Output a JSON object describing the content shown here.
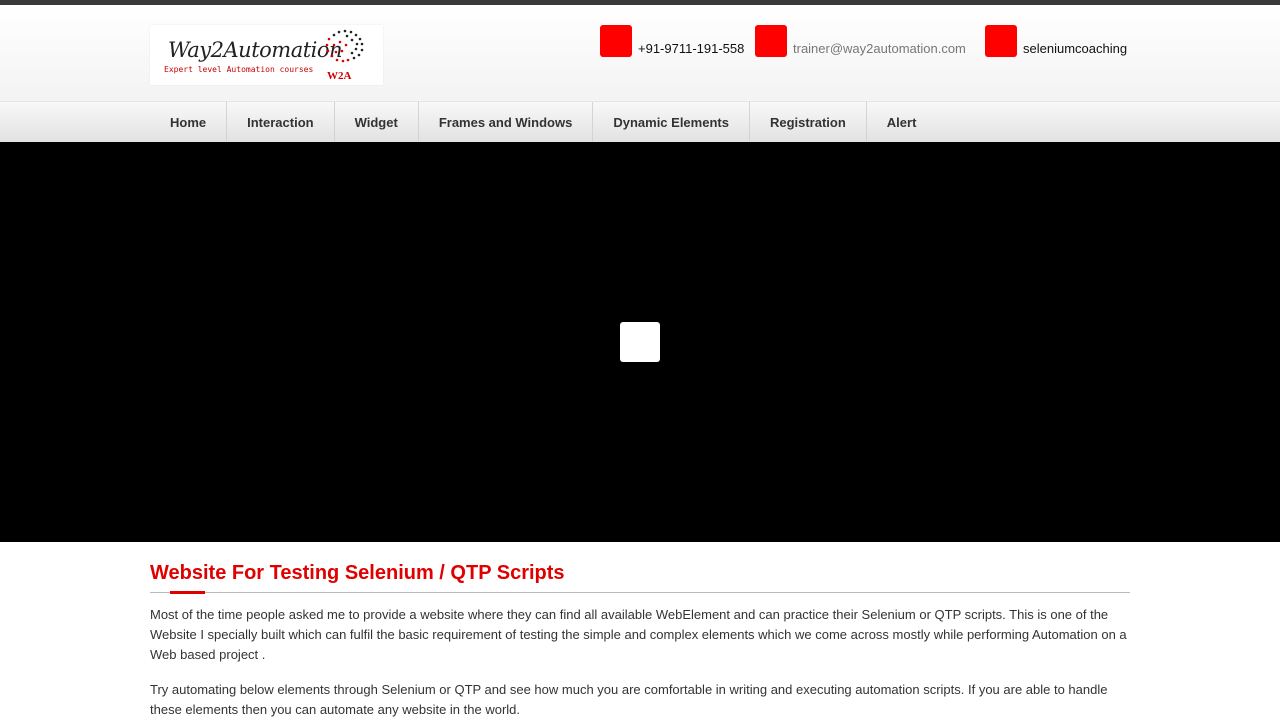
{
  "header": {
    "logo": {
      "brand": "Way2Automation",
      "tagline": "Expert level Automation courses",
      "mark": "W2A"
    },
    "contacts": [
      {
        "icon": "phone-icon",
        "text": "+91-9711-191-558"
      },
      {
        "icon": "email-icon",
        "text": "trainer@way2automation.com"
      },
      {
        "icon": "skype-icon",
        "text": "seleniumcoaching"
      }
    ]
  },
  "nav": {
    "items": [
      "Home",
      "Interaction",
      "Widget",
      "Frames and Windows",
      "Dynamic Elements",
      "Registration",
      "Alert"
    ]
  },
  "video": {
    "play_icon": "play-icon"
  },
  "main": {
    "title": "Website For Testing Selenium / QTP Scripts",
    "paragraphs": [
      "Most of the time people asked me to provide a website where they can find all available WebElement and can practice their Selenium or QTP scripts. This is one of the Website I specially built which can fulfil the basic requirement of testing the simple and complex elements which we come across mostly while performing Automation on a Web based project .",
      "Try automating below elements through Selenium or QTP and see how much you are comfortable in writing and executing automation scripts. If you are able to handle these elements then you can automate any website in the world."
    ]
  },
  "colors": {
    "accent": "#ff0000",
    "title": "#e00000",
    "video_bg": "#000000"
  }
}
